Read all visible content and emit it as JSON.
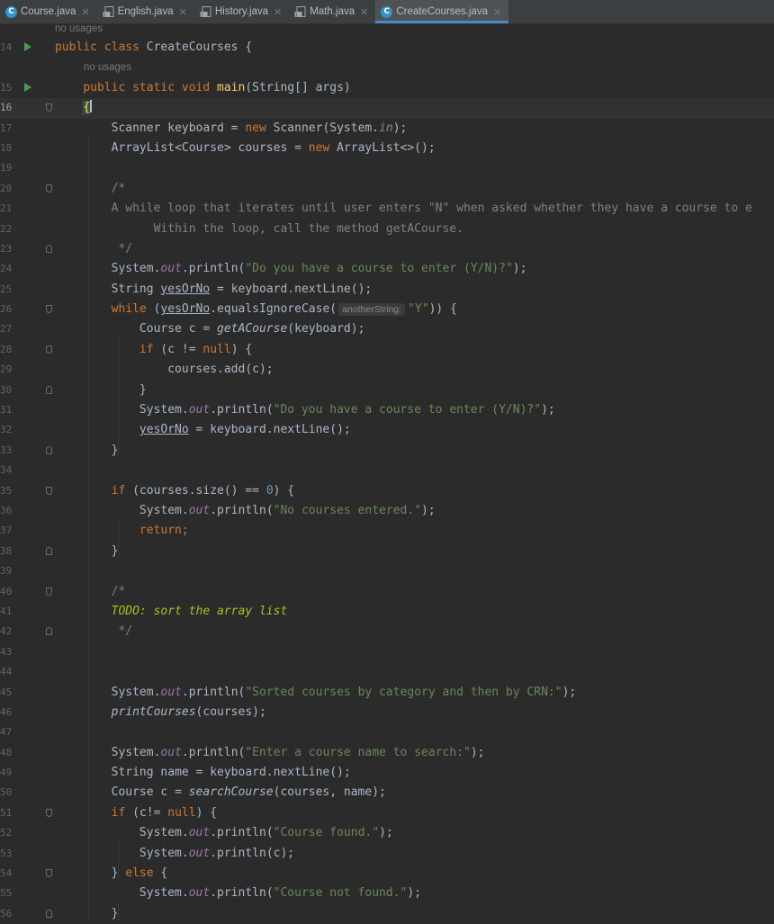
{
  "tabs": [
    {
      "label": "Course.java",
      "icon": "class-icon",
      "active": false
    },
    {
      "label": "English.java",
      "icon": "java-file-icon",
      "active": false
    },
    {
      "label": "History.java",
      "icon": "java-file-icon",
      "active": false
    },
    {
      "label": "Math.java",
      "icon": "java-file-icon",
      "active": false
    },
    {
      "label": "CreateCourses.java",
      "icon": "class-icon",
      "active": true
    }
  ],
  "hints": {
    "no_usages_1": "no usages",
    "no_usages_2": "no usages"
  },
  "param_hint": "anotherString:",
  "line_numbers": [
    "14",
    "15",
    "16",
    "17",
    "18",
    "19",
    "20",
    "21",
    "22",
    "23",
    "24",
    "25",
    "26",
    "27",
    "28",
    "29",
    "30",
    "31",
    "32",
    "33",
    "34",
    "35",
    "36",
    "37",
    "38",
    "39",
    "40",
    "41",
    "42",
    "43",
    "44",
    "45",
    "46",
    "47",
    "48",
    "49",
    "50",
    "51",
    "52",
    "53",
    "54",
    "55",
    "56"
  ],
  "current_line": "16",
  "code": {
    "l14": {
      "kw": "public class",
      "name": "CreateCourses",
      "rest": " {"
    },
    "l15": {
      "kw": "public static void",
      "fn": "main",
      "rest": "(String[] args)"
    },
    "l16": {
      "brace": "{"
    },
    "l17": {
      "a": "Scanner keyboard = ",
      "kw": "new",
      "b": " Scanner(System.",
      "st": "in",
      "c": ");"
    },
    "l18": {
      "a": "ArrayList<Course> courses = ",
      "kw": "new",
      "b": " ArrayList<>();"
    },
    "l20": {
      "text": "/*"
    },
    "l21": {
      "text": "A while loop that iterates until user enters \"N\" when asked whether they have a course to e"
    },
    "l22": {
      "text": "      Within the loop, call the method getACourse."
    },
    "l23": {
      "text": " */"
    },
    "l24": {
      "a": "System.",
      "st": "out",
      "b": ".println(",
      "str": "\"Do you have a course to enter (Y/N)?\"",
      "c": ");"
    },
    "l25": {
      "a": "String ",
      "ul": "yesOrNo",
      "b": " = keyboard.nextLine();"
    },
    "l26": {
      "kw": "while",
      "a": " (",
      "ul": "yesOrNo",
      "b": ".equalsIgnoreCase(",
      "str": "\"Y\"",
      "c": ")) {"
    },
    "l27": {
      "a": "Course c = ",
      "it": "getACourse",
      "b": "(keyboard);"
    },
    "l28": {
      "kw": "if",
      "a": " (c != ",
      "kw2": "null",
      "b": ") {"
    },
    "l29": {
      "a": "courses.add(c);"
    },
    "l30": {
      "a": "}"
    },
    "l31": {
      "a": "System.",
      "st": "out",
      "b": ".println(",
      "str": "\"Do you have a course to enter (Y/N)?\"",
      "c": ");"
    },
    "l32": {
      "ul": "yesOrNo",
      "b": " = keyboard.nextLine();"
    },
    "l33": {
      "a": "}"
    },
    "l35": {
      "kw": "if",
      "a": " (courses.size() == ",
      "num": "0",
      "b": ") {"
    },
    "l36": {
      "a": "System.",
      "st": "out",
      "b": ".println(",
      "str": "\"No courses entered.\"",
      "c": ");"
    },
    "l37": {
      "kw": "return;"
    },
    "l38": {
      "a": "}"
    },
    "l40": {
      "text": "/*"
    },
    "l41": {
      "text": "TODO: sort the array list"
    },
    "l42": {
      "text": " */"
    },
    "l45": {
      "a": "System.",
      "st": "out",
      "b": ".println(",
      "str": "\"Sorted courses by category and then by CRN:\"",
      "c": ");"
    },
    "l46": {
      "it": "printCourses",
      "b": "(courses);"
    },
    "l48": {
      "a": "System.",
      "st": "out",
      "b": ".println(",
      "str": "\"Enter a course name to search:\"",
      "c": ");"
    },
    "l49": {
      "a": "String name = keyboard.nextLine();"
    },
    "l50": {
      "a": "Course c = ",
      "it": "searchCourse",
      "b": "(courses, name);"
    },
    "l51": {
      "kw": "if",
      "a": " (c!= ",
      "kw2": "null",
      "b": ") {"
    },
    "l52": {
      "a": "System.",
      "st": "out",
      "b": ".println(",
      "str": "\"Course found.\"",
      "c": ");"
    },
    "l53": {
      "a": "System.",
      "st": "out",
      "b": ".println(c);"
    },
    "l54": {
      "a": "} ",
      "kw": "else",
      "b": " {"
    },
    "l55": {
      "a": "System.",
      "st": "out",
      "b": ".println(",
      "str": "\"Course not found.\"",
      "c": ");"
    },
    "l56": {
      "a": "}"
    }
  }
}
